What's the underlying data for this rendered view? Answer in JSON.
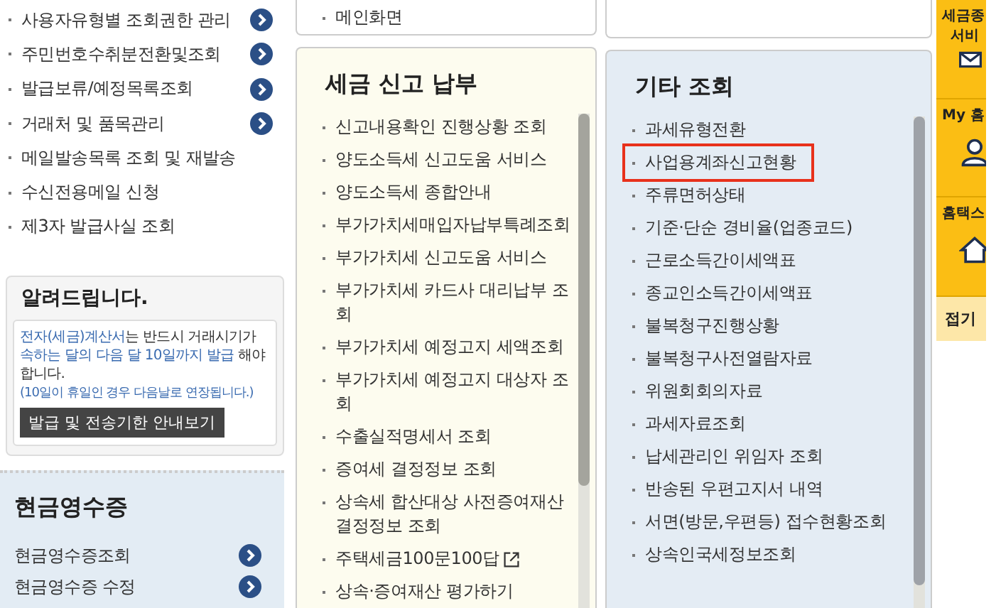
{
  "left_menu": {
    "items": [
      {
        "label": "사용자유형별 조회권한 관리",
        "has_arrow": true
      },
      {
        "label": "주민번호수취분전환및조회",
        "has_arrow": true
      },
      {
        "label": "발급보류/예정목록조회",
        "has_arrow": true
      },
      {
        "label": "거래처 및 품목관리",
        "has_arrow": true
      },
      {
        "label": "메일발송목록 조회 및 재발송",
        "has_arrow": false
      },
      {
        "label": "수신전용메일 신청",
        "has_arrow": false
      },
      {
        "label": "제3자 발급사실 조회",
        "has_arrow": false
      }
    ]
  },
  "notice": {
    "title": "알려드립니다.",
    "message": "**전자(세금)계산서**는 반드시 거래시기가 **속하는 달의 다음 달 10일까지 발급** 해야 합니다.",
    "note": "(10일이 휴일인 경우 다음날로 연장됩니다.)",
    "button": "발급 및 전송기한 안내보기"
  },
  "cash_receipt": {
    "title": "현금영수증",
    "items": [
      {
        "label": "현금영수증조회",
        "has_arrow": true
      },
      {
        "label": "현금영수증 수정",
        "has_arrow": true
      }
    ]
  },
  "top_card": {
    "item": "메인화면"
  },
  "tax_filing": {
    "title": "세금 신고 납부",
    "items": [
      {
        "label": "신고내용확인 진행상황 조회",
        "external": false
      },
      {
        "label": "양도소득세 신고도움 서비스",
        "external": false
      },
      {
        "label": "양도소득세 종합안내",
        "external": false
      },
      {
        "label": "부가가치세매입자납부특례조회",
        "external": false
      },
      {
        "label": "부가가치세 신고도움 서비스",
        "external": false
      },
      {
        "label": "부가가치세 카드사 대리납부 조회",
        "external": false
      },
      {
        "label": "부가가치세 예정고지 세액조회",
        "external": false
      },
      {
        "label": "부가가치세 예정고지 대상자 조회",
        "external": false
      },
      {
        "label": "수출실적명세서 조회",
        "external": false
      },
      {
        "label": "증여세 결정정보 조회",
        "external": false
      },
      {
        "label": "상속세 합산대상 사전증여재산 결정정보 조회",
        "external": false
      },
      {
        "label": "주택세금100문100답",
        "external": true
      },
      {
        "label": "상속·증여재산 평가하기",
        "external": false
      }
    ]
  },
  "other_inquiry": {
    "title": "기타 조회",
    "items": [
      {
        "label": "과세유형전환",
        "highlighted": false
      },
      {
        "label": "사업용계좌신고현황",
        "highlighted": true
      },
      {
        "label": "주류면허상태",
        "highlighted": false
      },
      {
        "label": "기준·단순 경비율(업종코드)",
        "highlighted": false
      },
      {
        "label": "근로소득간이세액표",
        "highlighted": false
      },
      {
        "label": "종교인소득간이세액표",
        "highlighted": false
      },
      {
        "label": "불복청구진행상황",
        "highlighted": false
      },
      {
        "label": "불복청구사전열람자료",
        "highlighted": false
      },
      {
        "label": "위원회회의자료",
        "highlighted": false
      },
      {
        "label": "과세자료조회",
        "highlighted": false
      },
      {
        "label": "납세관리인 위임자 조회",
        "highlighted": false
      },
      {
        "label": "반송된 우편고지서 내역",
        "highlighted": false
      },
      {
        "label": "서면(방문,우편등) 접수현황조회",
        "highlighted": false
      },
      {
        "label": "상속인국세정보조회",
        "highlighted": false
      }
    ]
  },
  "quick_bar": {
    "items": [
      {
        "label": "세금종",
        "sublabel": "서비",
        "kind": "mail"
      },
      {
        "label": "My 홈",
        "kind": "person"
      },
      {
        "label": "홈택스",
        "kind": "home"
      }
    ],
    "fold": "접기"
  }
}
